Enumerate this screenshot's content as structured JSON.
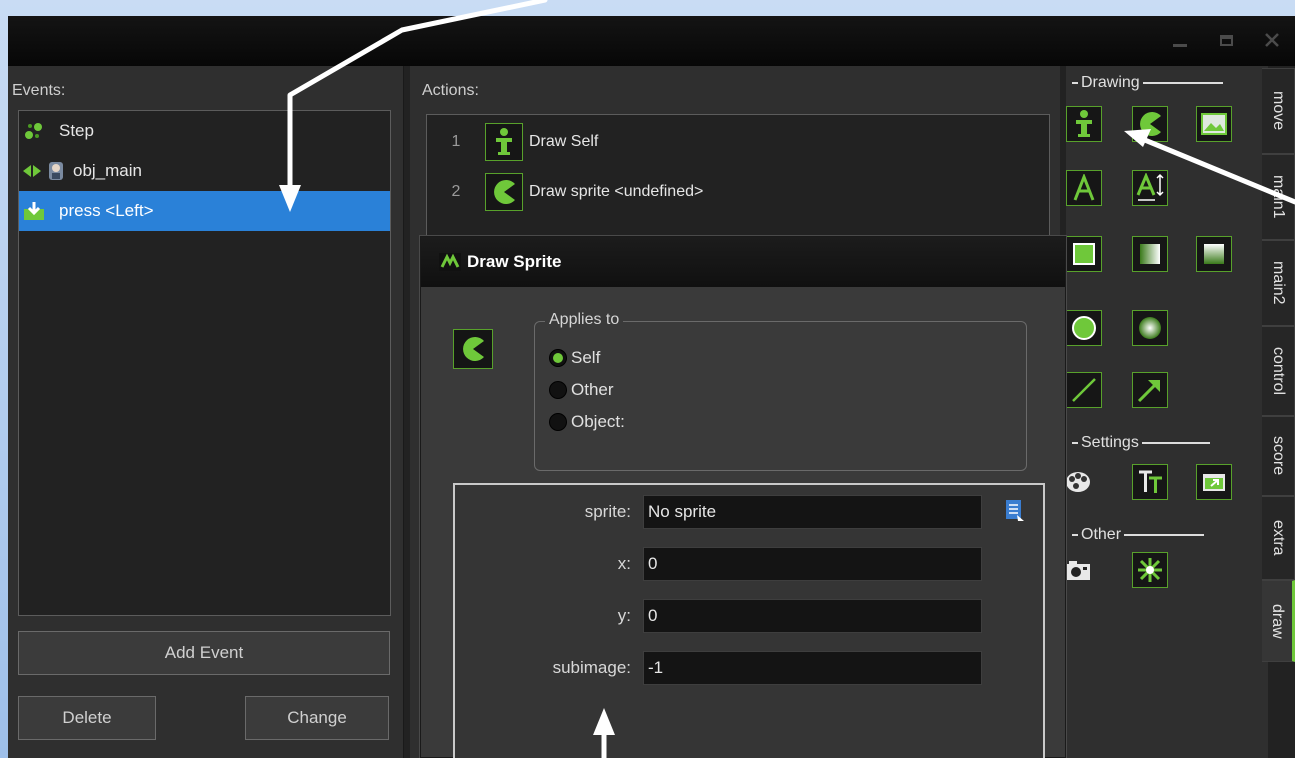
{
  "window": {
    "controls": [
      "minimize",
      "maximize",
      "close"
    ]
  },
  "events": {
    "label": "Events:",
    "items": [
      {
        "label": "Step",
        "icon": "step-icon"
      },
      {
        "label": "obj_main",
        "icon": "collision-icon"
      },
      {
        "label": "press <Left>",
        "icon": "key-press-icon",
        "selected": true
      }
    ],
    "add_event": "Add Event",
    "delete": "Delete",
    "change": "Change"
  },
  "actions": {
    "label": "Actions:",
    "items": [
      {
        "num": "1",
        "label": "Draw Self",
        "icon": "draw-self-icon"
      },
      {
        "num": "2",
        "label": "Draw sprite <undefined>",
        "icon": "draw-sprite-icon"
      }
    ]
  },
  "dialog": {
    "title": "Draw Sprite",
    "applies_to": {
      "legend": "Applies to",
      "options": [
        "Self",
        "Other",
        "Object:"
      ],
      "selected": "Self"
    },
    "fields": [
      {
        "label": "sprite:",
        "value": "No sprite"
      },
      {
        "label": "x:",
        "value": "0"
      },
      {
        "label": "y:",
        "value": "0"
      },
      {
        "label": "subimage:",
        "value": "-1"
      }
    ]
  },
  "palette": {
    "sections": {
      "drawing": "Drawing",
      "settings": "Settings",
      "other": "Other"
    },
    "tabs": [
      "move",
      "main1",
      "main2",
      "control",
      "score",
      "extra",
      "draw"
    ],
    "active_tab": "draw"
  },
  "colors": {
    "accent_green": "#6fc83a",
    "selection_blue": "#2a81d8",
    "panel_bg": "#2f2f2f"
  }
}
